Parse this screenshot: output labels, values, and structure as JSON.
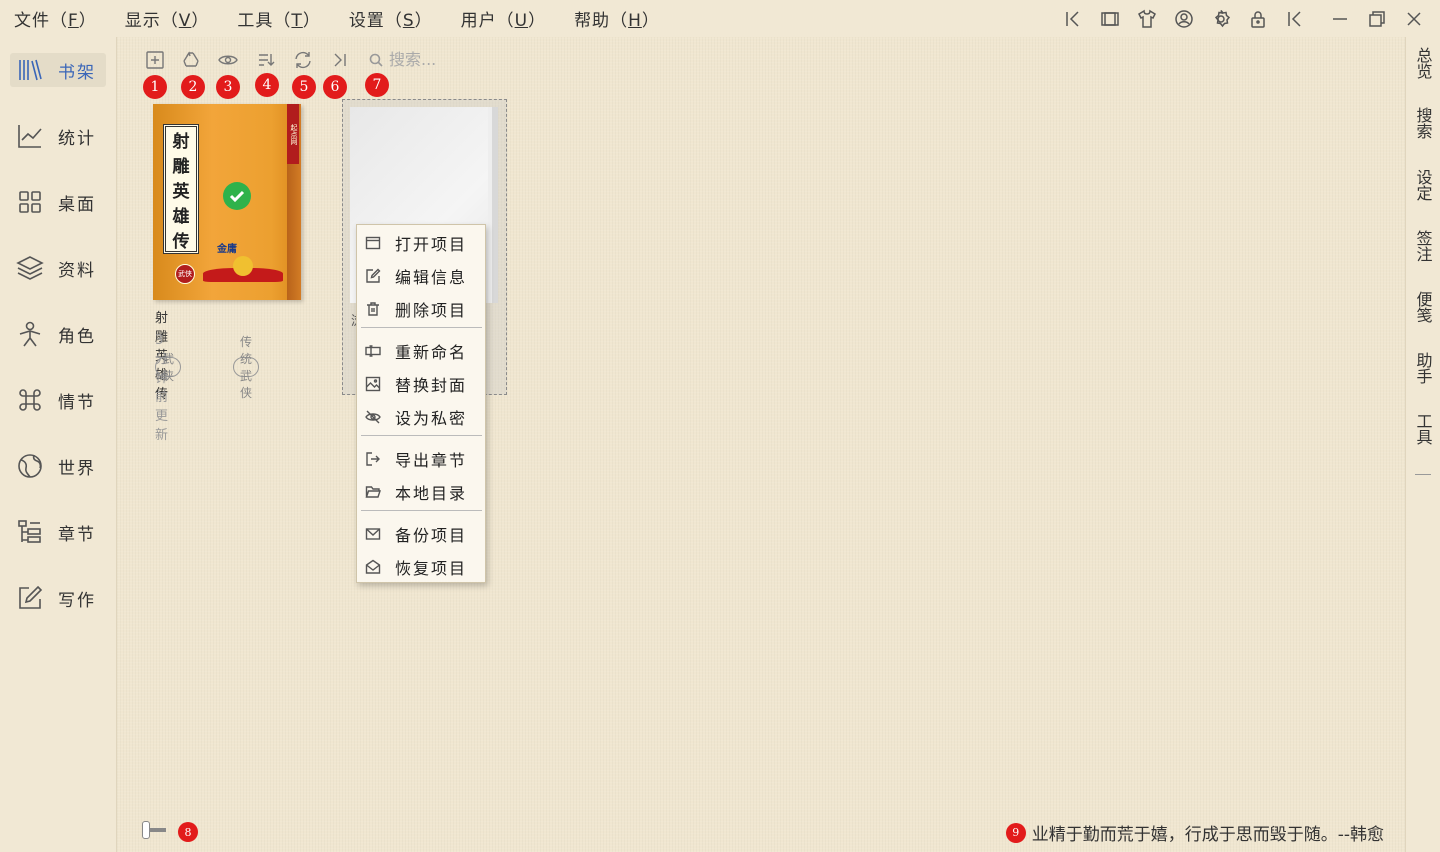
{
  "menubar": {
    "items": [
      {
        "label": "文件",
        "key": "F"
      },
      {
        "label": "显示",
        "key": "V"
      },
      {
        "label": "工具",
        "key": "T"
      },
      {
        "label": "设置",
        "key": "S"
      },
      {
        "label": "用户",
        "key": "U"
      },
      {
        "label": "帮助",
        "key": "H"
      }
    ],
    "window_icons": [
      "collapse-left-icon",
      "frame-icon",
      "skin-icon",
      "user-circle-icon",
      "settings-icon",
      "lock-icon",
      "collapse-left-icon",
      "minimize-icon",
      "restore-icon",
      "close-icon"
    ]
  },
  "sidebar": {
    "items": [
      {
        "label": "书架",
        "icon": "bookshelf-icon",
        "active": true
      },
      {
        "label": "统计",
        "icon": "chart-line-icon"
      },
      {
        "label": "桌面",
        "icon": "grid-icon"
      },
      {
        "label": "资料",
        "icon": "layers-icon"
      },
      {
        "label": "角色",
        "icon": "person-icon"
      },
      {
        "label": "情节",
        "icon": "command-icon"
      },
      {
        "label": "世界",
        "icon": "globe-icon"
      },
      {
        "label": "章节",
        "icon": "tree-list-icon"
      },
      {
        "label": "写作",
        "icon": "edit-square-icon"
      }
    ]
  },
  "right_bar": {
    "items": [
      "总览",
      "搜索",
      "设定",
      "签注",
      "便笺",
      "助手",
      "工具"
    ]
  },
  "toolbar": {
    "icons": [
      "add-square-icon",
      "recycle-icon",
      "eye-icon",
      "sort-icon",
      "refresh-icon",
      "skip-end-icon"
    ],
    "search_placeholder": "搜索...",
    "badges": [
      "1",
      "2",
      "3",
      "4",
      "5",
      "6",
      "7"
    ]
  },
  "books": [
    {
      "title": "射雕英雄传",
      "updated": "3分钟前更新",
      "tags": [
        "武侠",
        "传统武侠"
      ],
      "cover_title_chars": [
        "射",
        "雕",
        "英",
        "雄",
        "传"
      ],
      "cover_author": "金庸",
      "cover_seal": "武侠",
      "cover_spine": "起点网"
    }
  ],
  "card2_peek": "浏",
  "context_menu": {
    "groups": [
      [
        {
          "label": "打开项目",
          "icon": "window-icon"
        },
        {
          "label": "编辑信息",
          "icon": "edit-icon"
        },
        {
          "label": "删除项目",
          "icon": "trash-icon"
        }
      ],
      [
        {
          "label": "重新命名",
          "icon": "rename-icon"
        },
        {
          "label": "替换封面",
          "icon": "image-icon"
        },
        {
          "label": "设为私密",
          "icon": "eye-off-icon"
        }
      ],
      [
        {
          "label": "导出章节",
          "icon": "export-icon"
        },
        {
          "label": "本地目录",
          "icon": "folder-open-icon"
        }
      ],
      [
        {
          "label": "备份项目",
          "icon": "mail-icon"
        },
        {
          "label": "恢复项目",
          "icon": "mail-open-icon"
        }
      ]
    ]
  },
  "footer": {
    "badge_slider": "8",
    "badge_quote": "9",
    "quote": "业精于勤而荒于嬉，行成于思而毁于随。--韩愈"
  },
  "colors": {
    "background": "#f1e8d4",
    "accent": "#3a66b8",
    "badge": "#e21b1b"
  }
}
